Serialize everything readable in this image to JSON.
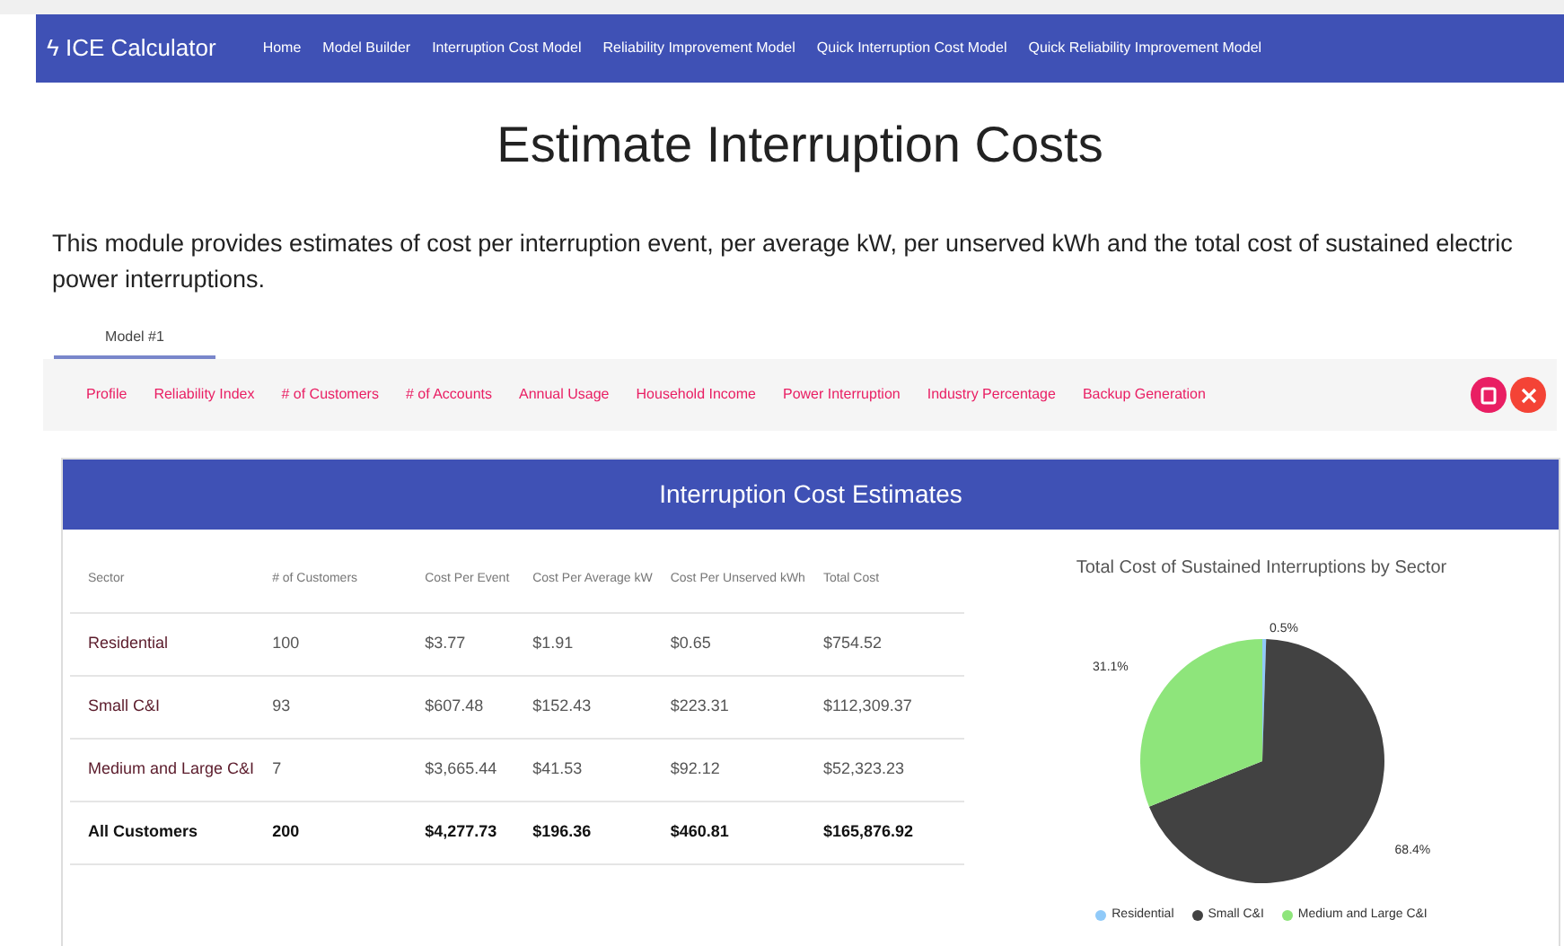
{
  "navbar": {
    "brand_icon": "ϟ",
    "brand": "ICE Calculator",
    "links": [
      {
        "label": "Home"
      },
      {
        "label": "Model Builder"
      },
      {
        "label": "Interruption Cost Model"
      },
      {
        "label": "Reliability Improvement Model"
      },
      {
        "label": "Quick Interruption Cost Model"
      },
      {
        "label": "Quick Reliability Improvement Model"
      }
    ]
  },
  "title": "Estimate Interruption Costs",
  "description": "This module provides estimates of cost per interruption event, per average kW, per unserved kWh and the total cost of sustained electric power interruptions.",
  "tabs": [
    {
      "label": "Model #1",
      "selected": true
    }
  ],
  "toolbar": {
    "links": [
      "Profile",
      "Reliability Index",
      "# of Customers",
      "# of Accounts",
      "Annual Usage",
      "Household Income",
      "Power Interruption",
      "Industry Percentage",
      "Backup Generation"
    ]
  },
  "card": {
    "title": "Interruption Cost Estimates",
    "table": {
      "columns": [
        "Sector",
        "# of Customers",
        "Cost Per Event",
        "Cost Per Average kW",
        "Cost Per Unserved kWh",
        "Total Cost"
      ],
      "rows": [
        {
          "cells": [
            "Residential",
            "100",
            "$3.77",
            "$1.91",
            "$0.65",
            "$754.52"
          ],
          "total": false
        },
        {
          "cells": [
            "Small C&I",
            "93",
            "$607.48",
            "$152.43",
            "$223.31",
            "$112,309.37"
          ],
          "total": false
        },
        {
          "cells": [
            "Medium and Large C&I",
            "7",
            "$3,665.44",
            "$41.53",
            "$92.12",
            "$52,323.23"
          ],
          "total": false
        },
        {
          "cells": [
            "All Customers",
            "200",
            "$4,277.73",
            "$196.36",
            "$460.81",
            "$165,876.92"
          ],
          "total": true
        }
      ]
    },
    "chart_data": {
      "type": "pie",
      "title": "Total Cost of Sustained Interruptions by Sector",
      "categories": [
        "Residential",
        "Small C&I",
        "Medium and Large C&I"
      ],
      "values": [
        0.5,
        68.4,
        31.1
      ],
      "legend": true,
      "colors": [
        "#90caf9",
        "#424242",
        "#8ee57b"
      ],
      "value_labels": [
        "0.5%",
        "68.4%",
        "31.1%"
      ]
    }
  }
}
